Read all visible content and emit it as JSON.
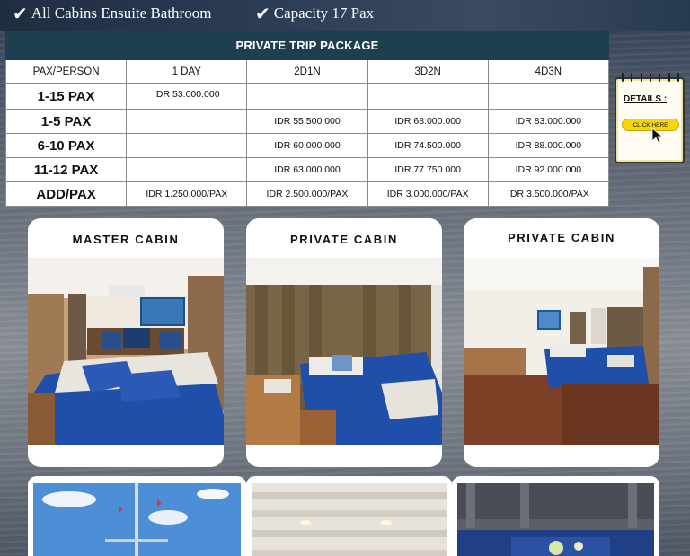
{
  "features": [
    {
      "label": "All Cabins Ensuite Bathroom"
    },
    {
      "label": "Capacity 17 Pax"
    }
  ],
  "price_table": {
    "title": "PRIVATE TRIP PACKAGE",
    "headers": [
      "PAX/PERSON",
      "1 DAY",
      "2D1N",
      "3D2N",
      "4D3N"
    ],
    "rows": [
      [
        "1-15 PAX",
        "IDR 53.000.000",
        "",
        "",
        ""
      ],
      [
        "1-5 PAX",
        "",
        "IDR 55.500.000",
        "IDR 68.000.000",
        "IDR 83.000.000"
      ],
      [
        "6-10 PAX",
        "",
        "IDR 60.000.000",
        "IDR 74.500.000",
        "IDR 88.000.000"
      ],
      [
        "11-12 PAX",
        "",
        "IDR 63.000.000",
        "IDR 77.750.000",
        "IDR 92.000.000"
      ],
      [
        "ADD/PAX",
        "IDR 1.250.000/PAX",
        "IDR 2.500.000/PAX",
        "IDR 3.000.000/PAX",
        "IDR 3.500.000/PAX"
      ]
    ]
  },
  "details": {
    "label": "DETAILS :",
    "button_label": "CLICK HERE"
  },
  "cabins": [
    {
      "title": "MASTER CABIN"
    },
    {
      "title": "PRIVATE CABIN"
    },
    {
      "title": "PRIVATE CABIN"
    }
  ],
  "colors": {
    "table_header": "#1d3f4f",
    "click_button": "#f5d60c",
    "bedding": "#1f4fa8"
  }
}
